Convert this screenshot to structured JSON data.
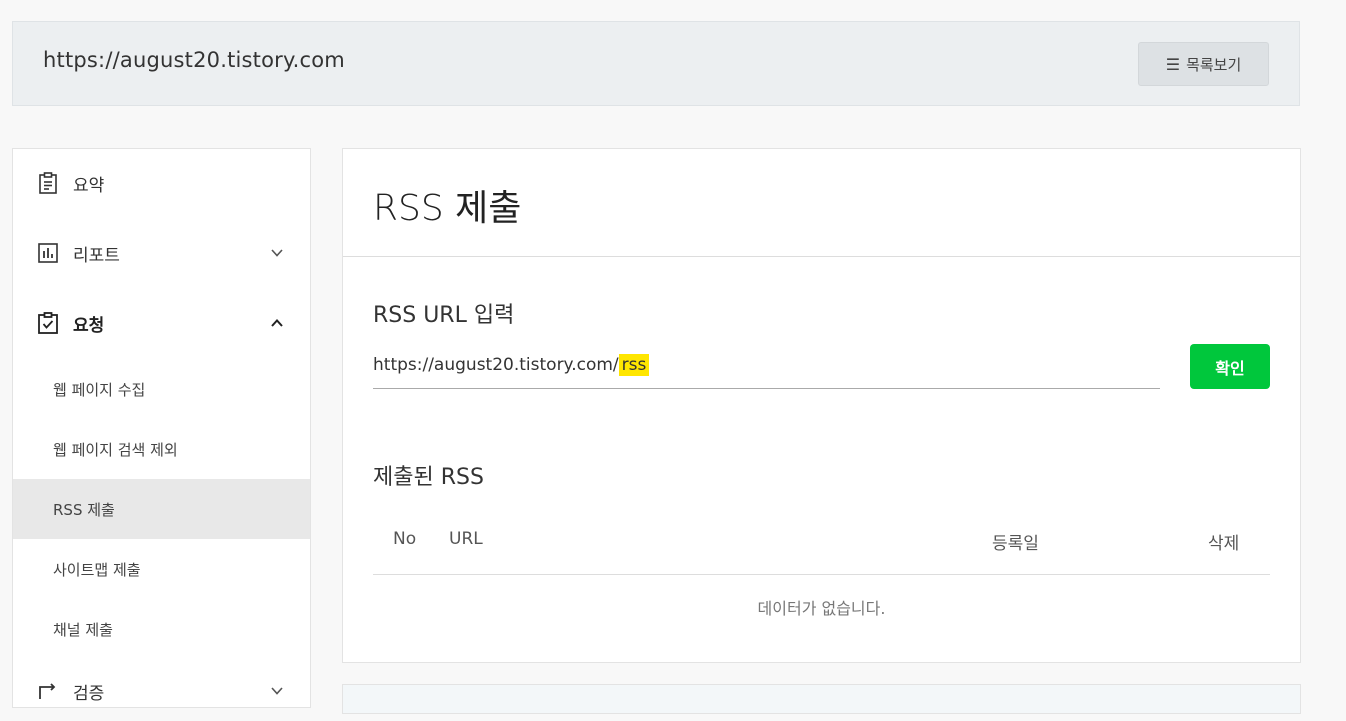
{
  "header": {
    "site_url": "https://august20.tistory.com",
    "list_button_label": "목록보기"
  },
  "sidebar": {
    "items": [
      {
        "label": "요약",
        "icon": "clipboard-icon"
      },
      {
        "label": "리포트",
        "icon": "bar-chart-icon",
        "expanded": false
      },
      {
        "label": "요청",
        "icon": "checklist-icon",
        "expanded": true
      },
      {
        "label": "검증",
        "icon": "swap-icon",
        "expanded": false
      }
    ],
    "sub_items": [
      {
        "label": "웹 페이지 수집"
      },
      {
        "label": "웹 페이지 검색 제외"
      },
      {
        "label": "RSS 제출",
        "active": true
      },
      {
        "label": "사이트맵 제출"
      },
      {
        "label": "채널 제출"
      }
    ]
  },
  "main": {
    "title": "RSS 제출",
    "input_section_label": "RSS URL 입력",
    "url_prefix": "https://august20.tistory.com/",
    "url_highlight": "rss",
    "confirm_label": "확인",
    "submitted_label": "제출된 RSS",
    "table": {
      "columns": [
        "No",
        "URL",
        "등록일",
        "삭제"
      ],
      "empty_text": "데이터가 없습니다."
    }
  },
  "colors": {
    "accent_green": "#00c73c",
    "highlight_yellow": "#ffe600",
    "active_bg": "#e8e8e8"
  }
}
